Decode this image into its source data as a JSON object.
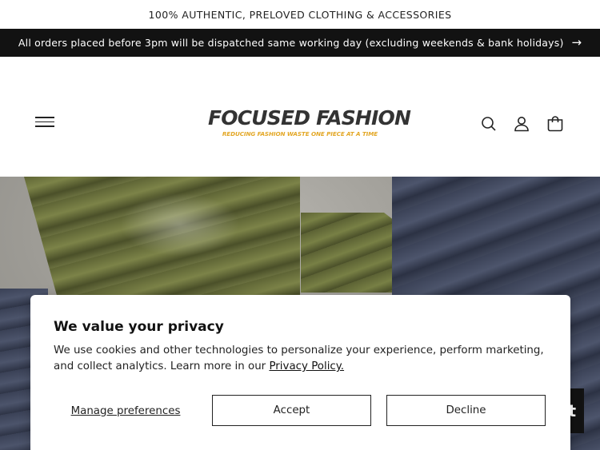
{
  "topbar": {
    "text": "100% AUTHENTIC, PRELOVED CLOTHING & ACCESSORIES"
  },
  "announcement": {
    "text": "All orders placed before 3pm will be dispatched same working day (excluding weekends & bank holidays)",
    "arrow_icon": "arrow-right-icon"
  },
  "header": {
    "logo_name": "FOCUSED FASHION",
    "logo_tagline": "REDUCING FASHION WASTE ONE PIECE AT A TIME",
    "logo_colors": {
      "name": "#333333",
      "tagline": "#e3a725"
    },
    "icons": [
      "menu-icon",
      "search-icon",
      "account-icon",
      "cart-icon"
    ]
  },
  "hero": {
    "description_colors": {
      "olive": "#6b7140",
      "navy": "#3f465a"
    }
  },
  "chat_widget": {
    "label": "t"
  },
  "cookie_banner": {
    "title": "We value your privacy",
    "body_text": "We use cookies and other technologies to personalize your experience, perform marketing, and collect analytics. Learn more in our ",
    "policy_link": "Privacy Policy.",
    "manage_label": "Manage preferences",
    "accept_label": "Accept",
    "decline_label": "Decline"
  }
}
